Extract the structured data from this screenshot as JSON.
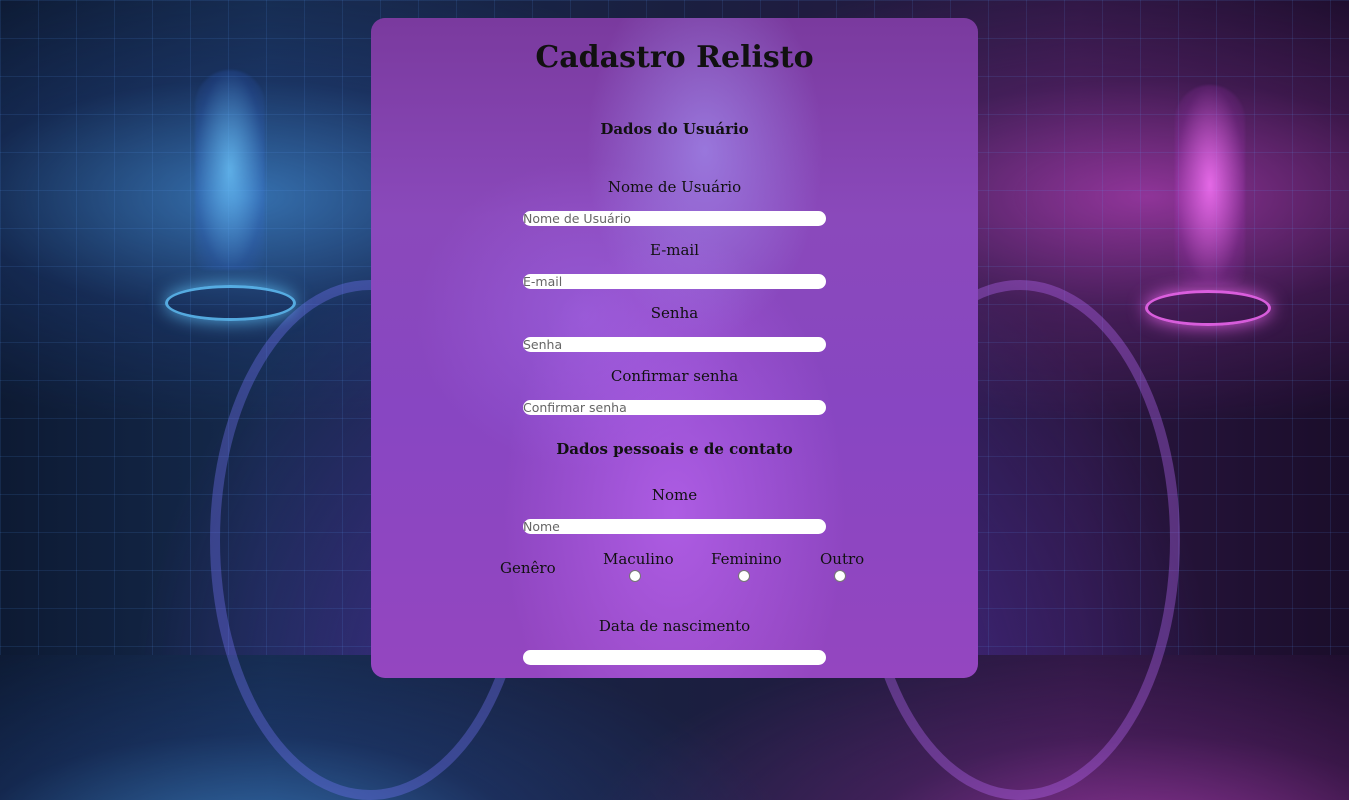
{
  "form": {
    "title": "Cadastro Relisto",
    "section_user": "Dados do Usuário",
    "username": {
      "label": "Nome de Usuário",
      "placeholder": "Nome de Usuário"
    },
    "email": {
      "label": "E-mail",
      "placeholder": "E-mail"
    },
    "password": {
      "label": "Senha",
      "placeholder": "Senha"
    },
    "confirm_password": {
      "label": "Confirmar senha",
      "placeholder": "Confirmar senha"
    },
    "section_personal": "Dados pessoais e de contato",
    "name": {
      "label": "Nome",
      "placeholder": "Nome"
    },
    "gender": {
      "label": "Genêro",
      "options": [
        "Maculino",
        "Feminino",
        "Outro"
      ]
    },
    "birthdate": {
      "label": "Data de nascimento"
    }
  },
  "colors": {
    "card_top": "#7a3a9e",
    "card_bottom": "#9446c0"
  }
}
